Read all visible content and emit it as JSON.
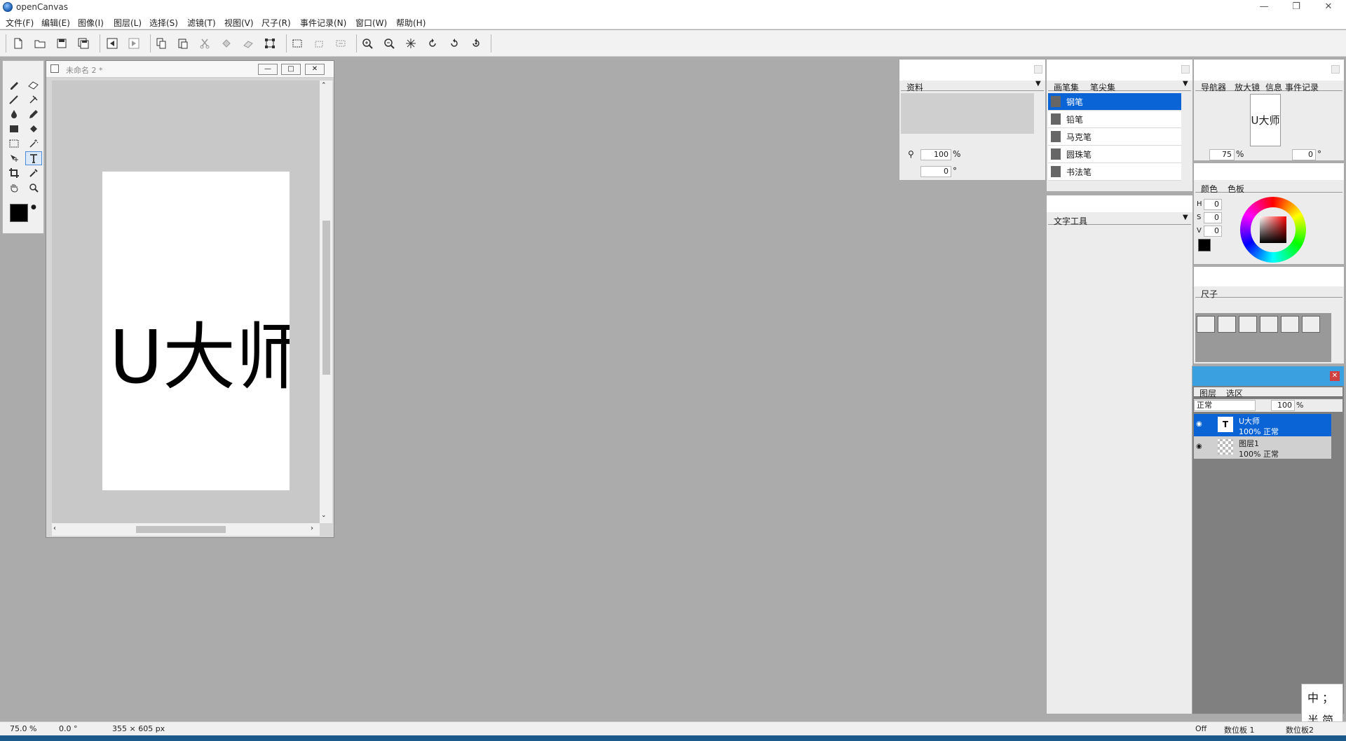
{
  "app": {
    "title": "openCanvas"
  },
  "menu": [
    "文件(F)",
    "编辑(E)",
    "图像(I)",
    "图层(L)",
    "选择(S)",
    "滤镜(T)",
    "视图(V)",
    "尺子(R)",
    "事件记录(N)",
    "窗口(W)",
    "帮助(H)"
  ],
  "document": {
    "title": "未命名 2 *",
    "text": "U大师"
  },
  "material_panel": {
    "tab": "资料",
    "zoom": "100",
    "zoom_unit": "%",
    "angle": "0",
    "angle_unit": "°"
  },
  "brush_panel": {
    "tabs": [
      "画笔集",
      "笔尖集"
    ],
    "brushes": [
      "钢笔",
      "铅笔",
      "马克笔",
      "圆珠笔",
      "书法笔"
    ],
    "selected_index": 0
  },
  "text_tool_panel": {
    "tab": "文字工具"
  },
  "navigator_panel": {
    "tabs": [
      "导航器",
      "放大镜",
      "信息",
      "事件记录"
    ],
    "thumb_text": "U大师",
    "zoom": "75",
    "zoom_unit": "%",
    "angle": "0",
    "angle_unit": "°"
  },
  "color_panel": {
    "tabs": [
      "颜色",
      "色板"
    ],
    "h_label": "H",
    "s_label": "S",
    "v_label": "V",
    "h": "0",
    "s": "0",
    "v": "0"
  },
  "ruler_panel": {
    "tab": "尺子"
  },
  "layer_panel": {
    "tabs": [
      "图层",
      "选区"
    ],
    "blend_mode": "正常",
    "opacity": "100",
    "opacity_unit": "%",
    "layers": [
      {
        "name": "U大师",
        "info": "100% 正常",
        "selected": true,
        "type_icon": "text-layer-icon"
      },
      {
        "name": "图层1",
        "info": "100% 正常",
        "selected": false,
        "type_icon": "raster-layer-icon"
      }
    ]
  },
  "ime": {
    "top": "中 ；",
    "bottom": "半 简"
  },
  "status": {
    "zoom": "75.0 %",
    "angle": "0.0 °",
    "size": "355 × 605 px",
    "mode": "Off",
    "tablet": "数位板 1",
    "tablet2": "数位板2"
  }
}
